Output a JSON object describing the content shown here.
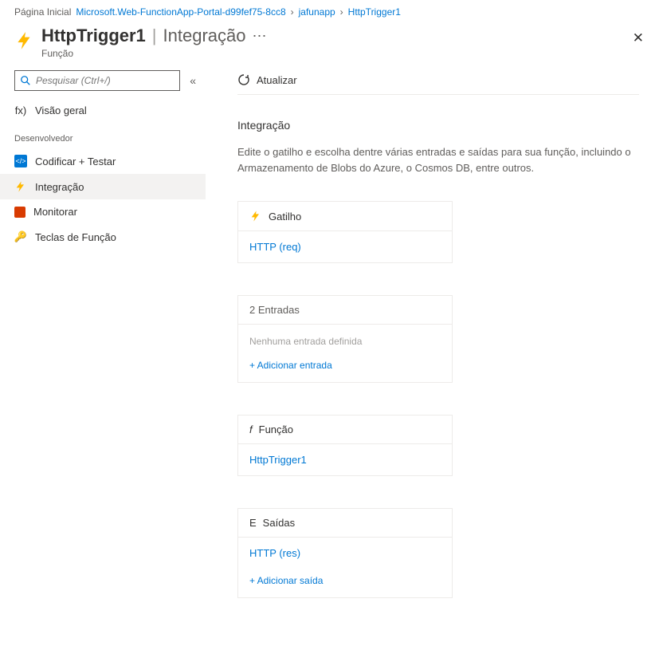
{
  "breadcrumb": {
    "home": "Página Inicial",
    "items": [
      "Microsoft.Web-FunctionApp-Portal-d99fef75-8cc8",
      "jafunapp",
      "HttpTrigger1"
    ]
  },
  "header": {
    "title": "HttpTrigger1",
    "section": "Integração",
    "subtitle": "Função"
  },
  "sidebar": {
    "search_placeholder": "Pesquisar (Ctrl+/)",
    "overview": "Visão geral",
    "section_dev": "Desenvolvedor",
    "items": [
      {
        "label": "Codificar + Testar"
      },
      {
        "label": "Integração"
      },
      {
        "label": "Monitorar"
      },
      {
        "label": "Teclas de Função"
      }
    ]
  },
  "toolbar": {
    "refresh": "Atualizar"
  },
  "content": {
    "heading": "Integração",
    "description": "Edite o gatilho e escolha dentre várias entradas e saídas para sua função, incluindo o Armazenamento de Blobs do Azure, o Cosmos DB, entre outros.",
    "trigger_card": {
      "title": "Gatilho",
      "link": "HTTP (req)"
    },
    "inputs_card": {
      "title": "2 Entradas",
      "empty": "Nenhuma entrada definida",
      "add": "+  Adicionar entrada"
    },
    "function_card": {
      "title": "Função",
      "prefix": "f",
      "link": "HttpTrigger1"
    },
    "outputs_card": {
      "title": "Saídas",
      "prefix": "E",
      "link": "HTTP (res)",
      "add": "+  Adicionar saída"
    }
  }
}
